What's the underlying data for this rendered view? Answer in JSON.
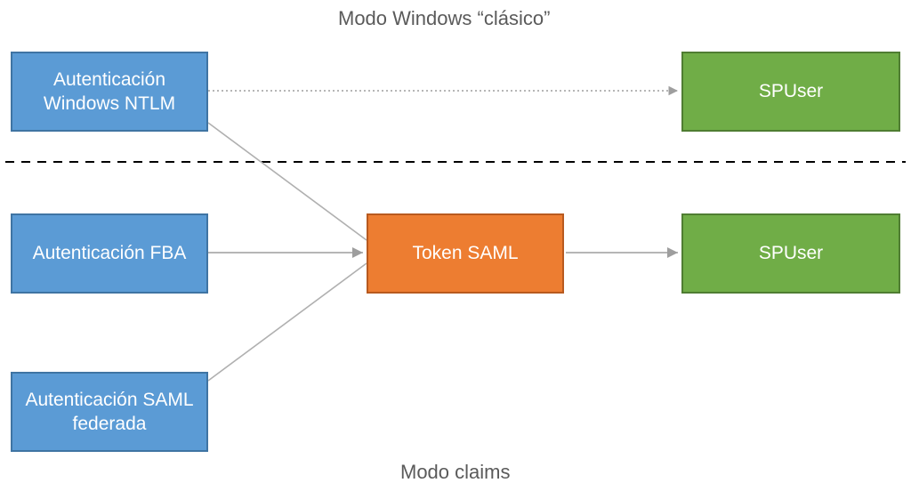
{
  "headings": {
    "top": "Modo Windows “clásico”",
    "bottom": "Modo claims"
  },
  "nodes": {
    "ntlm": "Autenticación Windows NTLM",
    "fba": "Autenticación FBA",
    "saml": "Autenticación SAML federada",
    "token": "Token SAML",
    "spuser1": "SPUser",
    "spuser2": "SPUser"
  },
  "colors": {
    "blue": "#5b9bd5",
    "orange": "#ed7d31",
    "green": "#70ad47",
    "text": "#5a5a5a",
    "arrow": "#9e9e9e",
    "line": "#b0b0b0"
  },
  "chart_data": {
    "type": "flow-diagram",
    "sections": [
      {
        "name": "Modo Windows “clásico”",
        "nodes": [
          "ntlm",
          "spuser1"
        ]
      },
      {
        "name": "Modo claims",
        "nodes": [
          "fba",
          "saml",
          "token",
          "spuser2"
        ]
      }
    ],
    "nodes": [
      {
        "id": "ntlm",
        "label": "Autenticación Windows NTLM",
        "color": "blue"
      },
      {
        "id": "fba",
        "label": "Autenticación FBA",
        "color": "blue"
      },
      {
        "id": "saml",
        "label": "Autenticación SAML federada",
        "color": "blue"
      },
      {
        "id": "token",
        "label": "Token SAML",
        "color": "orange"
      },
      {
        "id": "spuser1",
        "label": "SPUser",
        "color": "green"
      },
      {
        "id": "spuser2",
        "label": "SPUser",
        "color": "green"
      }
    ],
    "edges": [
      {
        "from": "ntlm",
        "to": "spuser1",
        "arrow": true,
        "style": "dotted"
      },
      {
        "from": "ntlm",
        "to": "token",
        "arrow": false,
        "style": "solid"
      },
      {
        "from": "fba",
        "to": "token",
        "arrow": true,
        "style": "solid"
      },
      {
        "from": "saml",
        "to": "token",
        "arrow": false,
        "style": "solid"
      },
      {
        "from": "token",
        "to": "spuser2",
        "arrow": true,
        "style": "solid"
      }
    ]
  }
}
